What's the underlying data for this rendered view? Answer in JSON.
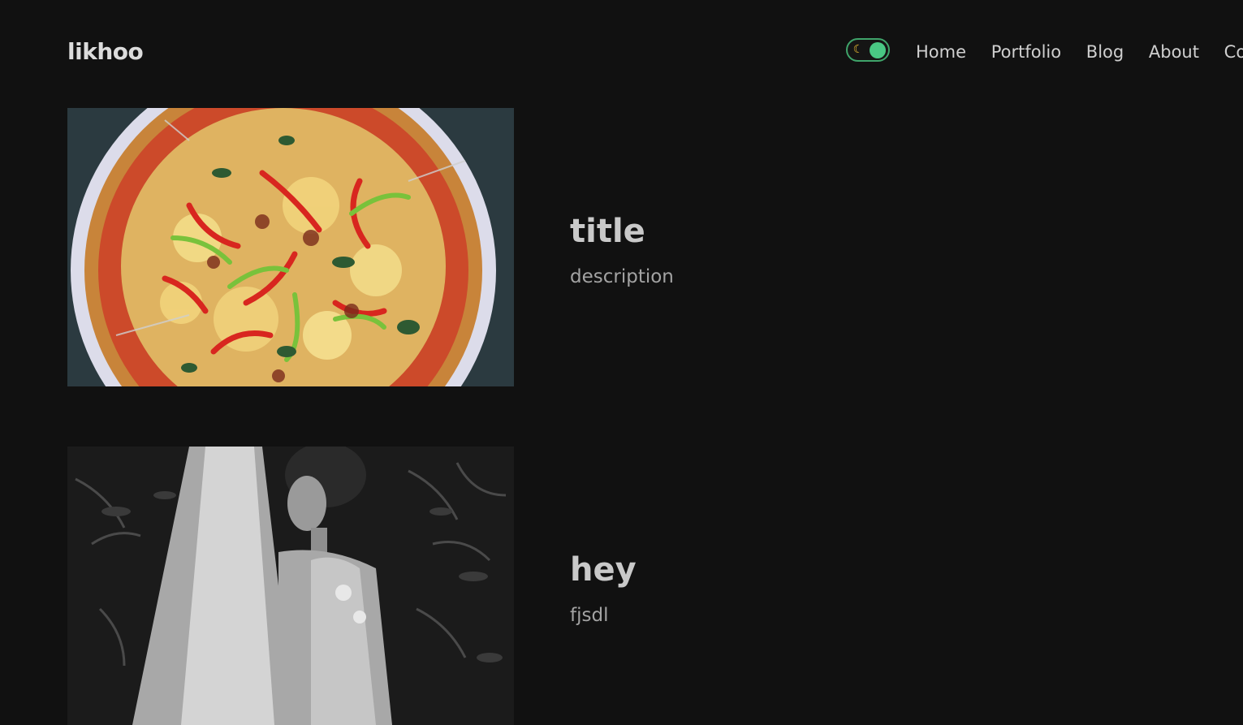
{
  "header": {
    "logo": "likhoo",
    "theme_toggle": {
      "icon": "moon-icon",
      "state": "dark",
      "accent_color": "#49c884",
      "border_color": "#3fa46a"
    },
    "nav": [
      {
        "label": "Home"
      },
      {
        "label": "Portfolio"
      },
      {
        "label": "Blog"
      },
      {
        "label": "About"
      },
      {
        "label": "Contact"
      }
    ]
  },
  "posts": [
    {
      "image": "pizza-photo",
      "title": "title",
      "description": "description"
    },
    {
      "image": "bride-veil-photo",
      "title": "hey",
      "description": "fjsdl"
    }
  ],
  "colors": {
    "background": "#111111",
    "title": "#c9c9c9",
    "description": "#a3a3a3"
  }
}
